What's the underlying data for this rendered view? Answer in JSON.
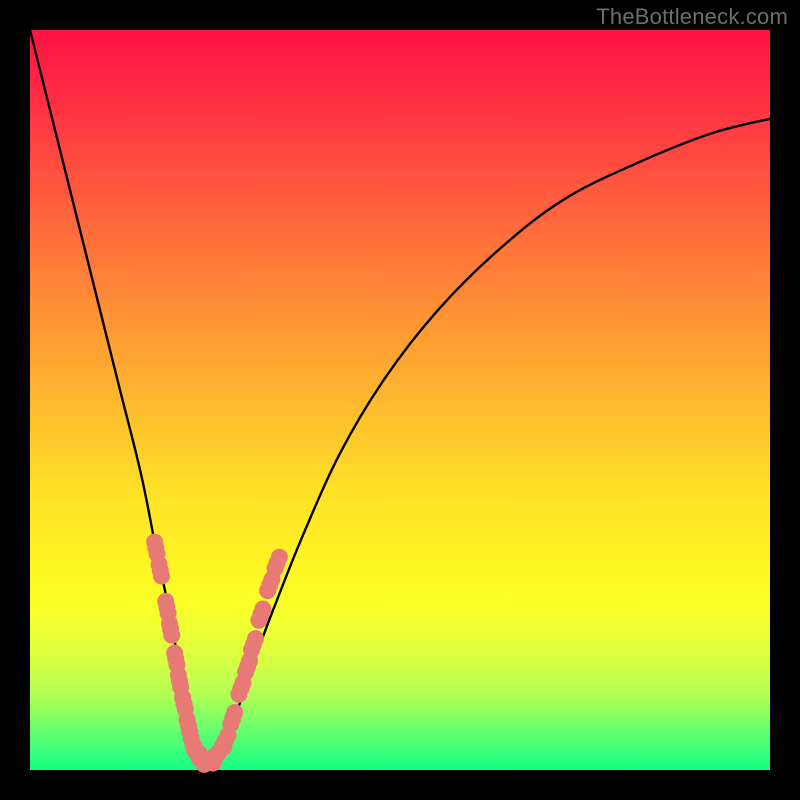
{
  "watermark": "TheBottleneck.com",
  "chart_data": {
    "type": "line",
    "title": "",
    "xlabel": "",
    "ylabel": "",
    "xlim": [
      0,
      100
    ],
    "ylim": [
      0,
      100
    ],
    "x": [
      0,
      3,
      6,
      9,
      12,
      15,
      17,
      18.5,
      20,
      21,
      22,
      23,
      24,
      25,
      26.5,
      28,
      30,
      33,
      37,
      42,
      48,
      55,
      63,
      72,
      82,
      92,
      100
    ],
    "y": [
      100,
      88,
      76,
      64,
      52,
      40,
      30,
      23,
      15,
      10,
      6,
      3,
      1.5,
      2,
      4,
      8,
      14,
      22,
      32,
      43,
      53,
      62,
      70,
      77,
      82,
      86,
      88
    ],
    "marker_groups": [
      {
        "name": "left-cluster",
        "color": "#e77a74",
        "points": [
          {
            "x": 17.0,
            "y": 30
          },
          {
            "x": 17.6,
            "y": 27
          },
          {
            "x": 18.5,
            "y": 22
          },
          {
            "x": 19.0,
            "y": 19
          },
          {
            "x": 19.7,
            "y": 15
          },
          {
            "x": 20.2,
            "y": 12
          },
          {
            "x": 20.8,
            "y": 9
          },
          {
            "x": 21.4,
            "y": 6
          }
        ]
      },
      {
        "name": "bottom-cluster",
        "color": "#e77a74",
        "points": [
          {
            "x": 22.0,
            "y": 3.5
          },
          {
            "x": 22.6,
            "y": 2.2
          },
          {
            "x": 23.2,
            "y": 1.5
          },
          {
            "x": 24.0,
            "y": 1.3
          },
          {
            "x": 24.8,
            "y": 1.6
          },
          {
            "x": 25.6,
            "y": 2.5
          },
          {
            "x": 26.4,
            "y": 4.0
          }
        ]
      },
      {
        "name": "right-cluster",
        "color": "#e77a74",
        "points": [
          {
            "x": 27.4,
            "y": 7
          },
          {
            "x": 28.5,
            "y": 11
          },
          {
            "x": 29.4,
            "y": 14
          },
          {
            "x": 30.2,
            "y": 17
          },
          {
            "x": 31.2,
            "y": 21
          },
          {
            "x": 32.4,
            "y": 25
          },
          {
            "x": 33.4,
            "y": 28
          }
        ]
      }
    ],
    "gradient_stops": [
      {
        "pos": 0,
        "color": "#ff1243"
      },
      {
        "pos": 8,
        "color": "#ff2a44"
      },
      {
        "pos": 22,
        "color": "#ff5a3e"
      },
      {
        "pos": 36,
        "color": "#ff8a36"
      },
      {
        "pos": 50,
        "color": "#ffb82e"
      },
      {
        "pos": 62,
        "color": "#ffe028"
      },
      {
        "pos": 72,
        "color": "#fff423"
      },
      {
        "pos": 78,
        "color": "#faff2a"
      },
      {
        "pos": 84,
        "color": "#e0ff3c"
      },
      {
        "pos": 90,
        "color": "#b0ff55"
      },
      {
        "pos": 95,
        "color": "#60ff70"
      },
      {
        "pos": 100,
        "color": "#12ff84"
      }
    ]
  }
}
